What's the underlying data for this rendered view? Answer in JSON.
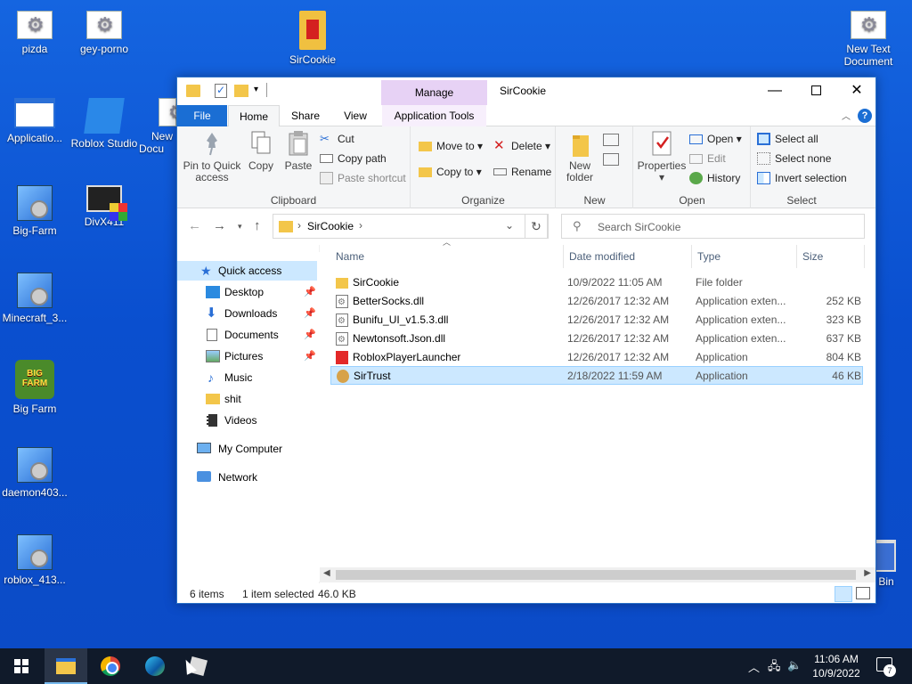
{
  "desktop": {
    "icons": [
      {
        "label": "pizda"
      },
      {
        "label": "gey-porno"
      },
      {
        "label": "SirCookie"
      },
      {
        "label": "New Text Document"
      },
      {
        "label": "Applicatio..."
      },
      {
        "label": "Roblox Studio"
      },
      {
        "label": "New Docu"
      },
      {
        "label": "Big-Farm"
      },
      {
        "label": "DivX411"
      },
      {
        "label": "Minecraft_3..."
      },
      {
        "label": "Big Farm"
      },
      {
        "label": "daemon403..."
      },
      {
        "label": "roblox_413..."
      },
      {
        "label": "Bin"
      }
    ]
  },
  "window": {
    "title": "SirCookie",
    "manage_tab": "Manage",
    "tabs": {
      "file": "File",
      "home": "Home",
      "share": "Share",
      "view": "View",
      "app_tools": "Application Tools"
    },
    "help": "?"
  },
  "ribbon": {
    "clipboard": {
      "label": "Clipboard",
      "pin": "Pin to Quick access",
      "copy": "Copy",
      "paste": "Paste",
      "cut": "Cut",
      "copy_path": "Copy path",
      "paste_shortcut": "Paste shortcut"
    },
    "organize": {
      "label": "Organize",
      "move_to": "Move to",
      "copy_to": "Copy to",
      "delete": "Delete",
      "rename": "Rename"
    },
    "new": {
      "label": "New",
      "new_folder": "New folder"
    },
    "open": {
      "label": "Open",
      "properties": "Properties",
      "open": "Open",
      "edit": "Edit",
      "history": "History"
    },
    "select": {
      "label": "Select",
      "select_all": "Select all",
      "select_none": "Select none",
      "invert": "Invert selection"
    }
  },
  "address": {
    "path": "SirCookie",
    "search_placeholder": "Search SirCookie"
  },
  "navpane": {
    "items": [
      {
        "label": "Quick access"
      },
      {
        "label": "Desktop"
      },
      {
        "label": "Downloads"
      },
      {
        "label": "Documents"
      },
      {
        "label": "Pictures"
      },
      {
        "label": "Music"
      },
      {
        "label": "shit"
      },
      {
        "label": "Videos"
      },
      {
        "label": "My Computer"
      },
      {
        "label": "Network"
      }
    ]
  },
  "filelist": {
    "headers": {
      "name": "Name",
      "date": "Date modified",
      "type": "Type",
      "size": "Size"
    },
    "rows": [
      {
        "name": "SirCookie",
        "date": "10/9/2022 11:05 AM",
        "type": "File folder",
        "size": "",
        "icon": "folder-icon"
      },
      {
        "name": "BetterSocks.dll",
        "date": "12/26/2017 12:32 AM",
        "type": "Application exten...",
        "size": "252 KB",
        "icon": "dll-icon"
      },
      {
        "name": "Bunifu_UI_v1.5.3.dll",
        "date": "12/26/2017 12:32 AM",
        "type": "Application exten...",
        "size": "323 KB",
        "icon": "dll-icon"
      },
      {
        "name": "Newtonsoft.Json.dll",
        "date": "12/26/2017 12:32 AM",
        "type": "Application exten...",
        "size": "637 KB",
        "icon": "dll-icon"
      },
      {
        "name": "RobloxPlayerLauncher",
        "date": "12/26/2017 12:32 AM",
        "type": "Application",
        "size": "804 KB",
        "icon": "roblox-icon"
      },
      {
        "name": "SirTrust",
        "date": "2/18/2022 11:59 AM",
        "type": "Application",
        "size": "46 KB",
        "icon": "cookie-icon"
      }
    ]
  },
  "status": {
    "items": "6 items",
    "selected": "1 item selected",
    "size": "46.0 KB"
  },
  "taskbar": {
    "time": "11:06 AM",
    "date": "10/9/2022",
    "notifications": "7"
  }
}
